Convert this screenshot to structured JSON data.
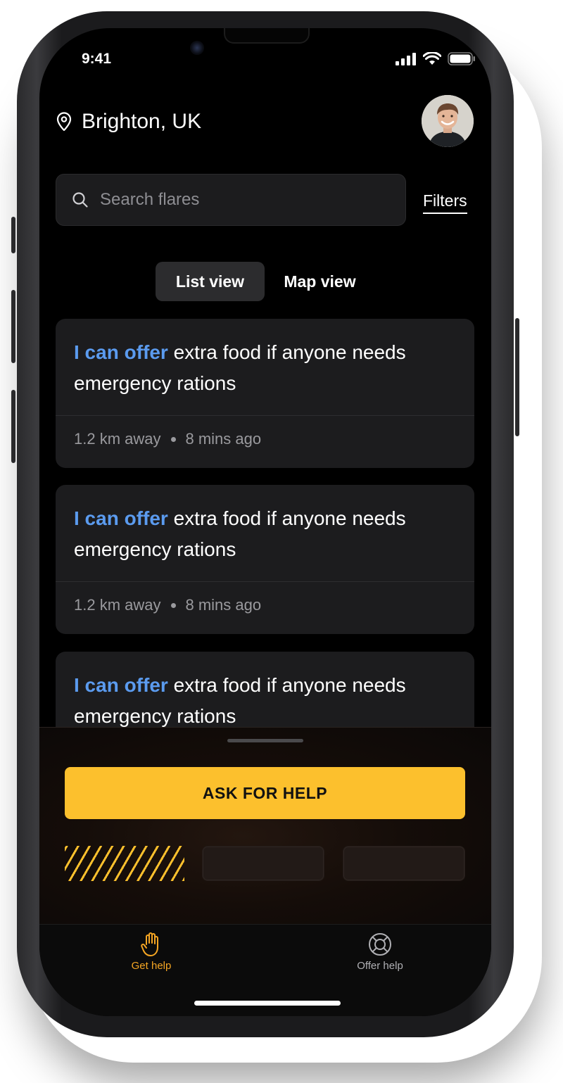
{
  "status": {
    "time": "9:41"
  },
  "location": {
    "name": "Brighton, UK"
  },
  "search": {
    "placeholder": "Search flares"
  },
  "filters_label": "Filters",
  "view_toggle": {
    "list": "List view",
    "map": "Map view",
    "selected": "List view"
  },
  "cards": [
    {
      "highlight": "I can offer",
      "text": " extra food if anyone needs emergency rations",
      "distance": "1.2 km away",
      "time": "8 mins ago"
    },
    {
      "highlight": "I can offer",
      "text": " extra food if anyone needs emergency rations",
      "distance": "1.2 km away",
      "time": "8 mins ago"
    },
    {
      "highlight": "I can offer",
      "text": " extra food if anyone needs emergency rations"
    }
  ],
  "sheet": {
    "ask_button": "ASK FOR HELP"
  },
  "tabs": [
    {
      "label": "Get help",
      "icon": "hand-icon",
      "active": true
    },
    {
      "label": "Offer help",
      "icon": "lifebuoy-icon",
      "active": false
    }
  ],
  "colors": {
    "accent": "#fcc02d",
    "highlight_text": "#5b9bef",
    "tab_active": "#f5a623"
  }
}
